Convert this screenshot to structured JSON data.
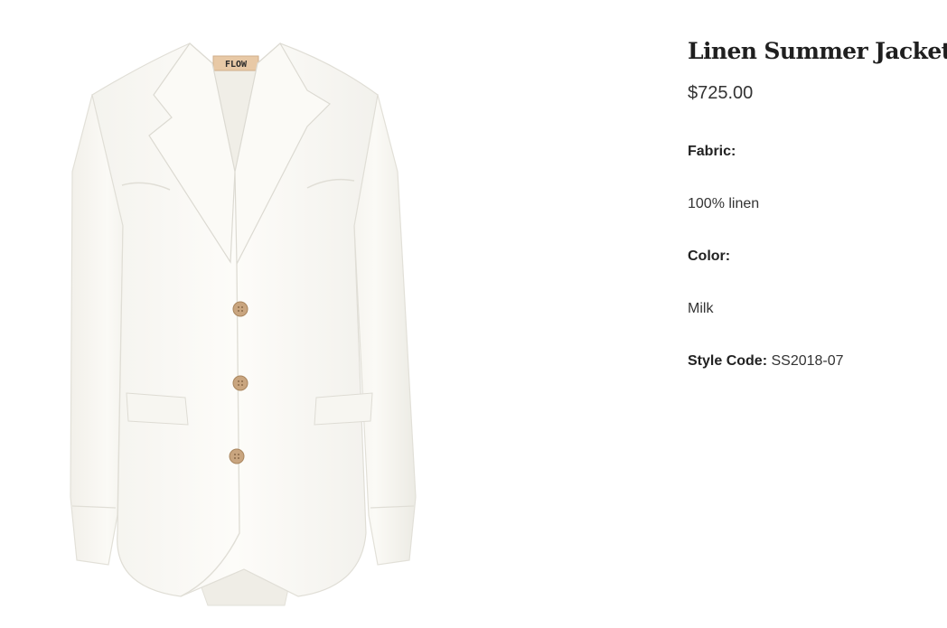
{
  "product": {
    "title": "Linen Summer Jacket",
    "price": "$725.00",
    "brand_label": "FLOW",
    "image_alt": "Linen Summer Jacket",
    "fabric_label": "Fabric:",
    "fabric_value": "100% linen",
    "color_label": "Color:",
    "color_value": "Milk",
    "style_code_label": "Style Code:",
    "style_code_value": "SS2018-07"
  },
  "colors": {
    "jacket": "#fbfaf6",
    "button": "#c9a57f",
    "label": "#e8c9a6"
  }
}
